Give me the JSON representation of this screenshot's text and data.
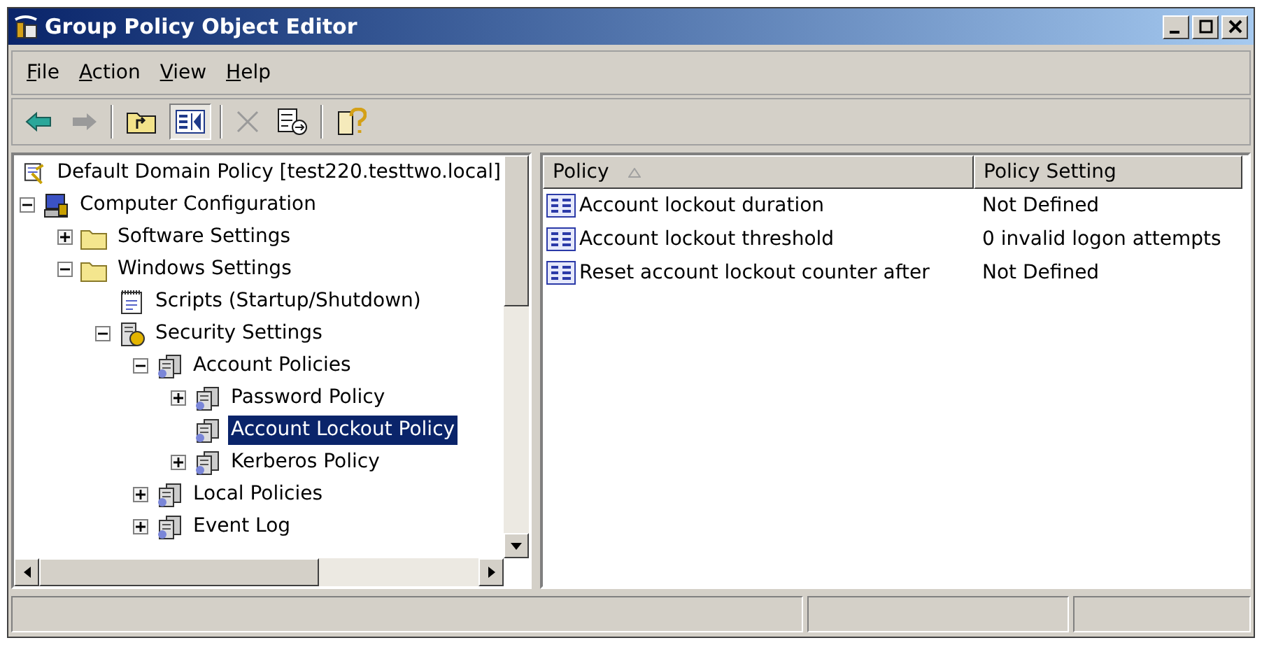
{
  "window": {
    "title": "Group Policy Object Editor"
  },
  "menu": [
    "File",
    "Action",
    "View",
    "Help"
  ],
  "toolbar": [
    {
      "kind": "back",
      "disabled": false
    },
    {
      "kind": "forward",
      "disabled": true
    },
    {
      "kind": "separator"
    },
    {
      "kind": "up",
      "disabled": false
    },
    {
      "kind": "tree",
      "disabled": false,
      "selected": true
    },
    {
      "kind": "separator"
    },
    {
      "kind": "delete",
      "disabled": true
    },
    {
      "kind": "export",
      "disabled": false
    },
    {
      "kind": "separator"
    },
    {
      "kind": "help",
      "disabled": false
    }
  ],
  "tree": [
    {
      "label": "Default Domain Policy [test220.testtwo.local]",
      "kind": "domain",
      "selected": false,
      "children": [
        {
          "label": "Computer Configuration",
          "kind": "computer",
          "expanded": true,
          "selected": false,
          "children": [
            {
              "label": "Software Settings",
              "kind": "folder",
              "expanded": false,
              "selected": false
            },
            {
              "label": "Windows Settings",
              "kind": "folder",
              "expanded": true,
              "selected": false,
              "children": [
                {
                  "label": "Scripts (Startup/Shutdown)",
                  "kind": "script",
                  "selected": false
                },
                {
                  "label": "Security Settings",
                  "kind": "security",
                  "expanded": true,
                  "selected": false,
                  "children": [
                    {
                      "label": "Account Policies",
                      "kind": "policy",
                      "expanded": true,
                      "selected": false,
                      "children": [
                        {
                          "label": "Password Policy",
                          "kind": "policy",
                          "expanded": false,
                          "selected": false
                        },
                        {
                          "label": "Account Lockout Policy",
                          "kind": "policy",
                          "selected": true
                        },
                        {
                          "label": "Kerberos Policy",
                          "kind": "policy",
                          "expanded": false,
                          "selected": false
                        }
                      ]
                    },
                    {
                      "label": "Local Policies",
                      "kind": "policy",
                      "expanded": false,
                      "selected": false
                    },
                    {
                      "label": "Event Log",
                      "kind": "policy",
                      "expanded": false,
                      "selected": false
                    }
                  ]
                }
              ]
            }
          ]
        }
      ]
    }
  ],
  "table": {
    "columns": [
      {
        "label": "Policy",
        "sorted": true
      },
      {
        "label": "Policy Setting",
        "sorted": false
      }
    ],
    "rows": [
      {
        "policy": "Account lockout duration",
        "setting": "Not Defined"
      },
      {
        "policy": "Account lockout threshold",
        "setting": "0 invalid logon attempts"
      },
      {
        "policy": "Reset account lockout counter after",
        "setting": "Not Defined"
      }
    ]
  }
}
